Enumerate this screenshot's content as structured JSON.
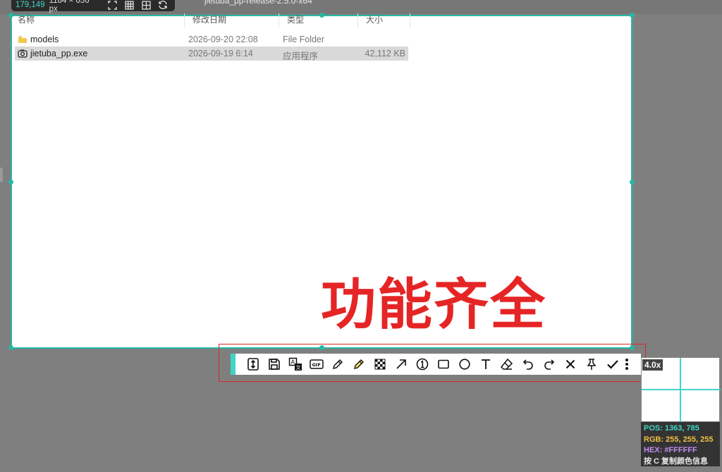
{
  "background": {
    "breadcrumb": "jietuba_pp-release-2.5.0-x64",
    "columns": {
      "name": "名称",
      "modified": "修改日期",
      "type": "类型",
      "size": "大小"
    },
    "files": [
      {
        "name": "models",
        "modified": "2026-09-20 22:08",
        "type": "File Folder",
        "size": "",
        "icon": "folder-icon"
      },
      {
        "name": "jietuba_pp.exe",
        "modified": "2026-09-19 6:14",
        "type": "应用程序",
        "size": "42,112 KB",
        "icon": "app-icon"
      }
    ]
  },
  "info_bar": {
    "position": "179,149",
    "size": "1184 × 636 px"
  },
  "overlay_text": "功能齐全",
  "toolbar": {
    "accent_color": "#3fd6c4",
    "tools": [
      {
        "name": "long-screenshot-icon"
      },
      {
        "name": "save-icon"
      },
      {
        "name": "translate-icon"
      },
      {
        "name": "gif-icon"
      },
      {
        "name": "pen-icon"
      },
      {
        "name": "highlighter-icon"
      },
      {
        "name": "mosaic-icon"
      },
      {
        "name": "arrow-icon"
      },
      {
        "name": "number-icon"
      },
      {
        "name": "rectangle-icon"
      },
      {
        "name": "circle-icon"
      },
      {
        "name": "text-icon"
      },
      {
        "name": "eraser-icon"
      },
      {
        "name": "undo-icon"
      },
      {
        "name": "redo-icon"
      },
      {
        "name": "close-icon"
      },
      {
        "name": "pin-icon"
      },
      {
        "name": "confirm-icon"
      }
    ]
  },
  "magnifier": {
    "zoom": "4.0x",
    "pos": "POS: 1363, 785",
    "rgb": "RGB: 255, 255, 255",
    "hex": "HEX: #FFFFFF",
    "hint": "按 C 复制颜色信息"
  },
  "colors": {
    "selection": "#26b8a5",
    "overlay_text": "#e52525",
    "outline": "#d42a2a"
  }
}
